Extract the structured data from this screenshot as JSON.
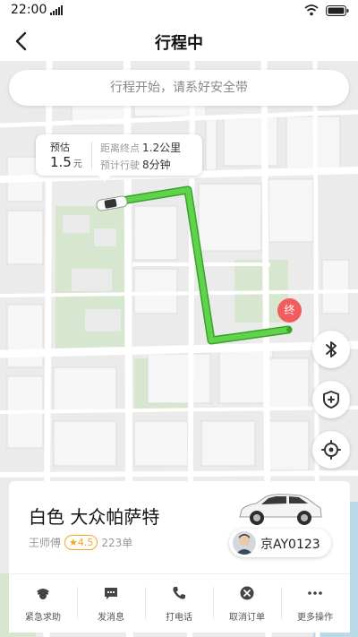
{
  "status_bar": {
    "time": "22:00"
  },
  "nav": {
    "title": "行程中"
  },
  "notice": {
    "text": "行程开始，请系好安全带"
  },
  "trip_info": {
    "estimate_label": "预估",
    "price": "1.5",
    "price_unit": "元",
    "distance_label": "距离终点",
    "distance_value": "1.2公里",
    "time_label": "预计行驶",
    "time_value": "8分钟"
  },
  "end_marker": {
    "label": "终"
  },
  "driver_card": {
    "car_description": "白色 大众帕萨特",
    "driver_name": "王师傅",
    "rating": "★4.5",
    "orders": "223单",
    "plate": "京AY0123"
  },
  "actions": [
    {
      "label": "紧急求助",
      "icon": "police-icon"
    },
    {
      "label": "发消息",
      "icon": "message-icon"
    },
    {
      "label": "打电话",
      "icon": "phone-icon"
    },
    {
      "label": "取消订单",
      "icon": "cancel-icon"
    },
    {
      "label": "更多操作",
      "icon": "more-icon"
    }
  ],
  "colors": {
    "route": "#52c41a",
    "end_marker": "#f25c5c",
    "rating": "#f5a623"
  }
}
